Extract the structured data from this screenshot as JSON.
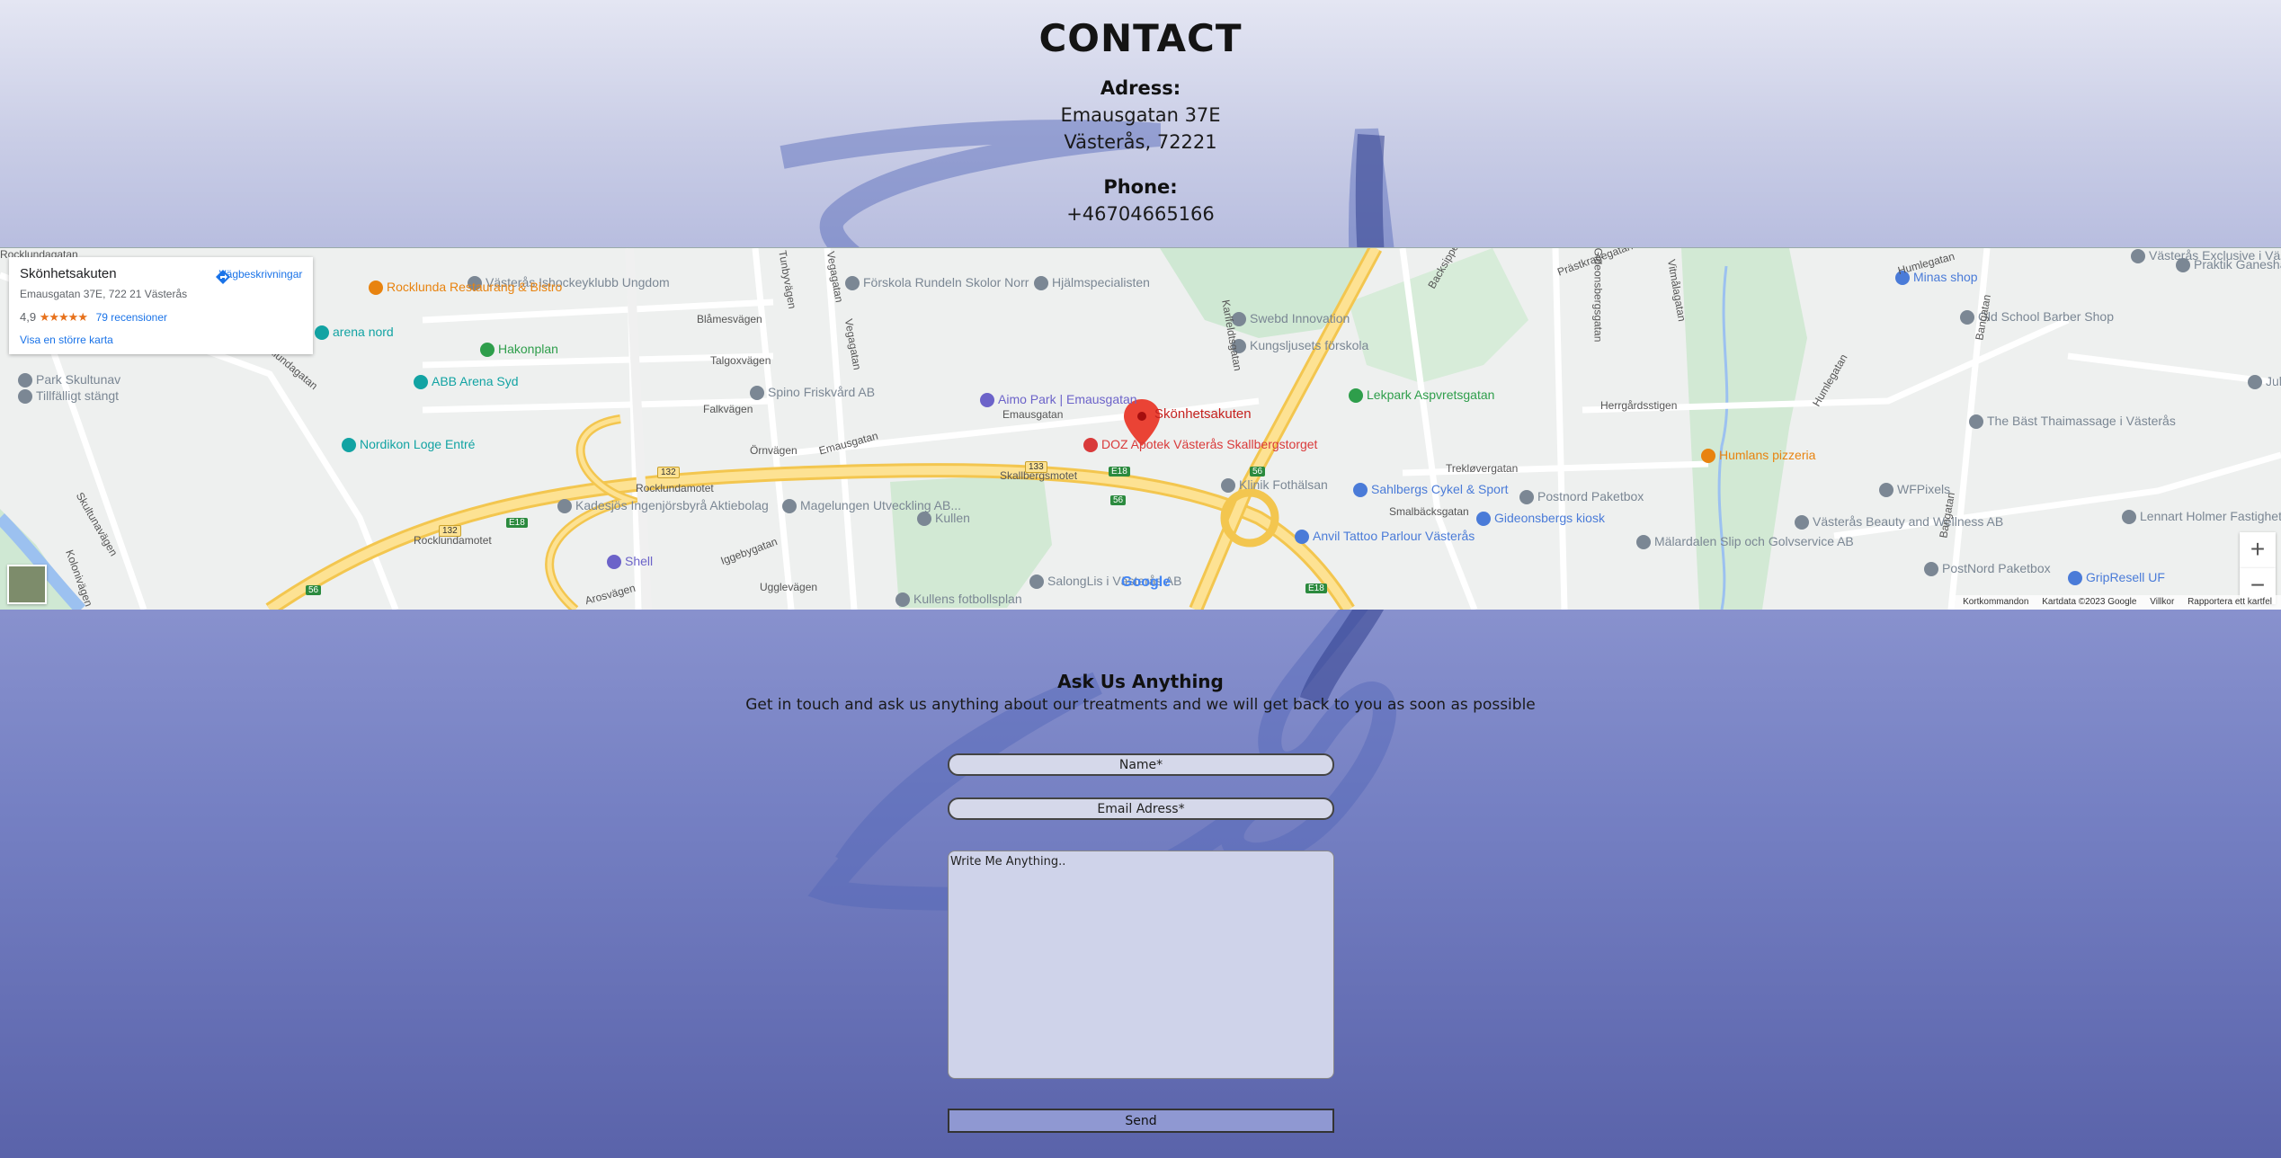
{
  "contact": {
    "title": "CONTACT",
    "address_label": "Adress:",
    "address_line1": "Emausgatan 37E",
    "address_line2": "Västerås, 72221",
    "phone_label": "Phone:",
    "phone": "+46704665166"
  },
  "map": {
    "card": {
      "name": "Skönhetsakuten",
      "address": "Emausgatan 37E, 722 21 Västerås",
      "rating": "4,9",
      "stars": "★★★★★",
      "reviews": "79 recensioner",
      "directions": "Vägbeskrivningar",
      "larger_map": "Visa en större karta"
    },
    "marker_label": "Skönhetsakuten",
    "zoom_in": "+",
    "zoom_out": "−",
    "google": "Google",
    "attribution": {
      "shortcuts": "Kortkommandon",
      "data": "Kartdata ©2023 Google",
      "terms": "Villkor",
      "report": "Rapportera ett kartfel"
    },
    "pois": [
      {
        "label": "Västerås Ishockeyklubb Ungdom",
        "color": "#7b8794"
      },
      {
        "label": "Förskola Rundeln Skolor Norr",
        "color": "#7b8794"
      },
      {
        "label": "Hjälmspecialisten",
        "color": "#7b8794"
      },
      {
        "label": "Swebd Innovation",
        "color": "#7b8794"
      },
      {
        "label": "Kungsljusets förskola",
        "color": "#7b8794"
      },
      {
        "label": "Praktik Ganesha",
        "color": "#7b8794"
      },
      {
        "label": "Minas shop",
        "color": "#4a7bd8"
      },
      {
        "label": "Västerås Exclusive i Västerås AB",
        "color": "#7b8794"
      },
      {
        "label": "Old School Barber Shop",
        "color": "#7b8794"
      },
      {
        "label": "Rocklunda Restaurang & Bistro",
        "color": "#e8830f"
      },
      {
        "label": "arena nord",
        "color": "#12a3a3"
      },
      {
        "label": "Hakonplan",
        "color": "#2e9e4b"
      },
      {
        "label": "ABB Arena Syd",
        "color": "#12a3a3"
      },
      {
        "label": "Park Skultunav",
        "color": "#7b8794"
      },
      {
        "label": "Tillfälligt stängt",
        "color": "#7b8794"
      },
      {
        "label": "Spino Friskvård AB",
        "color": "#7b8794"
      },
      {
        "label": "Aimo Park | Emausgatan",
        "color": "#6c63c9"
      },
      {
        "label": "DOZ Apotek Västerås Skallbergstorget",
        "color": "#d93a3a"
      },
      {
        "label": "Lekpark Aspvretsgatan",
        "color": "#2e9e4b"
      },
      {
        "label": "Nordikon Loge Entré",
        "color": "#12a3a3"
      },
      {
        "label": "Kadesjös Ingenjörsbyrå Aktiebolag",
        "color": "#7b8794"
      },
      {
        "label": "Magelungen Utveckling AB...",
        "color": "#7b8794"
      },
      {
        "label": "Kullen",
        "color": "#7b8794"
      },
      {
        "label": "Klinik Fothälsan",
        "color": "#7b8794"
      },
      {
        "label": "Sahlbergs Cykel & Sport",
        "color": "#4a7bd8"
      },
      {
        "label": "Postnord Paketbox",
        "color": "#7b8794"
      },
      {
        "label": "Gideonsbergs kiosk",
        "color": "#4a7bd8"
      },
      {
        "label": "Humlans pizzeria",
        "color": "#e8830f"
      },
      {
        "label": "WFPixels",
        "color": "#7b8794"
      },
      {
        "label": "The Bäst Thaimassage i Västerås",
        "color": "#7b8794"
      },
      {
        "label": "Shell",
        "color": "#6c63c9"
      },
      {
        "label": "Anvil Tattoo Parlour Västerås",
        "color": "#4a7bd8"
      },
      {
        "label": "Mälardalen Slip och Golvservice AB",
        "color": "#7b8794"
      },
      {
        "label": "Västerås Beauty and Wellness AB",
        "color": "#7b8794"
      },
      {
        "label": "SalongLis i Västerås AB",
        "color": "#7b8794"
      },
      {
        "label": "Kullens fotbollsplan",
        "color": "#7b8794"
      },
      {
        "label": "PostNord Paketbox",
        "color": "#7b8794"
      },
      {
        "label": "GripResell UF",
        "color": "#4a7bd8"
      },
      {
        "label": "Lennart Holmer Fastighetsförva",
        "color": "#7b8794"
      },
      {
        "label": "Julia",
        "color": "#7b8794"
      }
    ],
    "roads": [
      "Blåmesvägen",
      "Talgoxvägen",
      "Falkvägen",
      "Örnvägen",
      "Emausgatan",
      "Emausgatan",
      "Tunbyvägen",
      "Vegagatan",
      "Vegagatan",
      "Karlfeldtsgatan",
      "Prästkragegatan",
      "Gideonsbergsgatan",
      "Vitmålagatan",
      "Herrgårdsstigen",
      "Humlegatan",
      "Humlegatan",
      "Bangatan",
      "Bangatan",
      "Trekløvergatan",
      "Smalbäcksgatan",
      "Rocklundagatan",
      "Rocklundagatan",
      "Skultunavägen",
      "Kolonivägen",
      "Iggebygatan",
      "Ugglevägen",
      "Arosvägen",
      "Backsippegatan",
      "Rocklundamotet",
      "Rocklundamotet",
      "Skallbergsmotet"
    ],
    "shields": [
      "E18",
      "E18",
      "E18",
      "56",
      "56",
      "56",
      "132",
      "132",
      "133"
    ]
  },
  "form": {
    "title": "Ask Us Anything",
    "subtitle": "Get in touch and ask us anything about our treatments and we will get back to you as soon as possible",
    "name_placeholder": "Name*",
    "email_placeholder": "Email Adress*",
    "message_placeholder": "Write Me Anything..",
    "send_label": "Send"
  }
}
